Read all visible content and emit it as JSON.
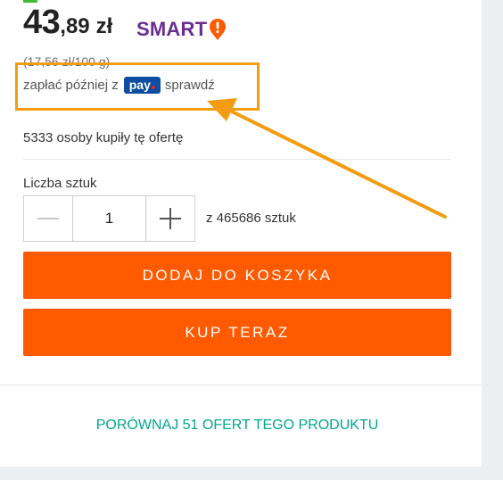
{
  "price": {
    "integer": "43",
    "decimal": ",89",
    "currency": "zł",
    "smart_badge": "SMART",
    "unit_price": "(17,56 zł/100 g)"
  },
  "pay_later": {
    "prefix": "zapłać później z",
    "logo_text": "pay",
    "link_label": "sprawdź"
  },
  "buyers_text": "5333 osoby kupiły tę ofertę",
  "quantity": {
    "label": "Liczba sztuk",
    "value": "1",
    "decrement_icon": "minus-icon",
    "increment_icon": "plus-icon",
    "availability": "z 465686 sztuk"
  },
  "buttons": {
    "add_to_cart": "DODAJ DO KOSZYKA",
    "buy_now": "KUP TERAZ"
  },
  "compare_link": "PORÓWNAJ 51 OFERT TEGO PRODUKTU",
  "colors": {
    "accent_orange": "#ff5a00",
    "annotation_orange": "#f39c12",
    "smart_purple": "#6b2c91",
    "pay_blue": "#0b4ea2",
    "link_teal": "#00a790"
  }
}
